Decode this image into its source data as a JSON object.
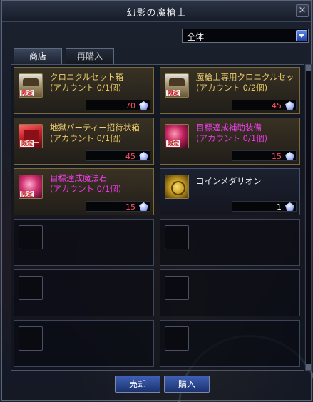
{
  "window": {
    "title": "幻影の魔槍士",
    "close_icon": "close-icon",
    "filter_value": "全体"
  },
  "tabs": [
    {
      "label": "商店",
      "active": true
    },
    {
      "label": "再購入",
      "active": false
    }
  ],
  "items": [
    {
      "name": "クロニクルセット箱",
      "limit": "(アカウント 0/1個)",
      "price": "70",
      "price_color": "#ff5060",
      "icon": "chest-icon",
      "badge": "限定",
      "color": "gold"
    },
    {
      "name": "魔槍士専用クロニクルセット箱",
      "limit": "(アカウント 0/2個)",
      "price": "45",
      "price_color": "#ff5060",
      "icon": "chest-icon",
      "badge": "限定",
      "color": "gold"
    },
    {
      "name": "地獄パーティー招待状箱",
      "limit": "(アカウント 0/1個)",
      "price": "45",
      "price_color": "#ff5060",
      "icon": "red-box-icon",
      "badge": "限定",
      "color": "gold"
    },
    {
      "name": "目標達成補助装備",
      "limit": "(アカウント 0/1個)",
      "price": "15",
      "price_color": "#ff5060",
      "icon": "gear-icon",
      "badge": "限定",
      "color": "magenta"
    },
    {
      "name": "目標達成魔法石",
      "limit": "(アカウント 0/1個)",
      "price": "15",
      "price_color": "#ff5060",
      "icon": "stone-icon",
      "badge": "限定",
      "color": "magenta"
    },
    {
      "name": "コインメダリオン",
      "limit": "",
      "price": "1",
      "price_color": "#f2f2f2",
      "icon": "coin-icon",
      "badge": "",
      "color": "white"
    }
  ],
  "currency_icon": "gem-icon",
  "buttons": {
    "sell": "売却",
    "buy": "購入"
  }
}
